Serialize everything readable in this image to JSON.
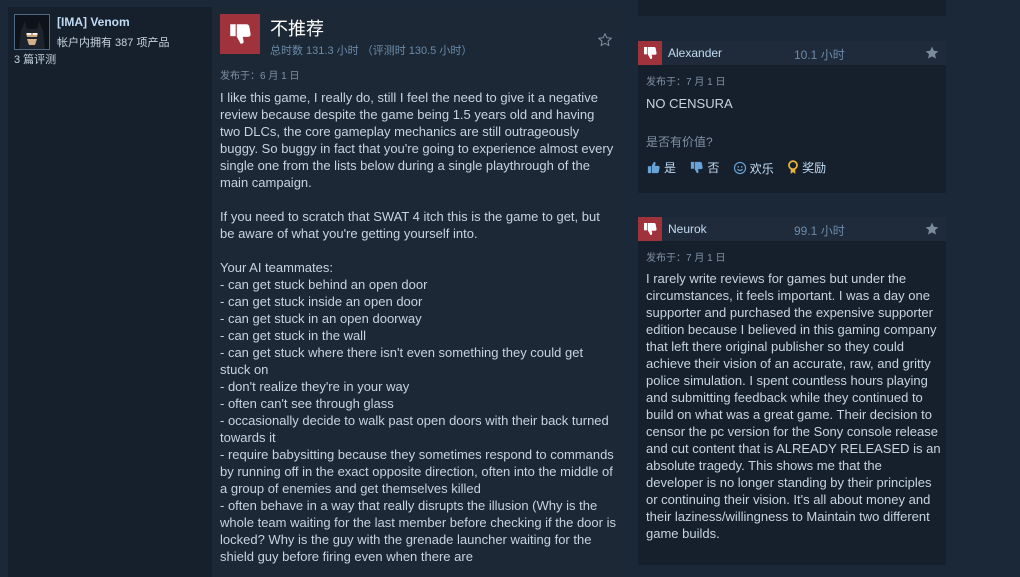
{
  "user": {
    "name": "[IMA] Venom",
    "products": "帐户内拥有 387 项产品",
    "reviews": "3 篇评测"
  },
  "review": {
    "verdict": "不推荐",
    "hours": "总时数 131.3 小时  （评测时 130.5 小时）",
    "posted": "发布于：6 月 1 日",
    "text": "I like this game, I really do, still I feel the need to give it a negative review because despite the game being 1.5 years old and having two DLCs, the core gameplay mechanics are still outrageously buggy. So buggy in fact that you're going to experience almost every single one from the lists below during a single playthrough of the main campaign.\n\nIf you need to scratch that SWAT 4 itch this is the game to get, but be aware of what you're getting yourself into.\n\nYour AI teammates:\n- can get stuck behind an open door\n- can get stuck inside an open door\n- can get stuck in an open doorway\n- can get stuck in the wall\n- can get stuck where there isn't even something they could get stuck on\n- don't realize they're in your way\n- often can't see through glass\n- occasionally decide to walk past open doors with their back turned towards it\n- require babysitting because they sometimes respond to commands by running off in the exact opposite direction, often into the middle of a group of enemies and get themselves killed\n- often behave in a way that really disrupts the illusion (Why is the whole team waiting for the last member before checking if the door is locked? Why is the guy with the grenade launcher waiting for the shield guy before firing even when there are"
  },
  "side_reviews": [
    {
      "author": "Alexander",
      "hours": "10.1 小时",
      "posted": "发布于：7 月 1 日",
      "text": "NO CENSURA",
      "helpful_question": "是否有价值?",
      "buttons": {
        "yes": "是",
        "no": "否",
        "funny": "欢乐",
        "award": "奖励"
      }
    },
    {
      "author": "Neurok",
      "hours": "99.1 小时",
      "posted": "发布于：7 月 1 日",
      "text": "I rarely write reviews for games but under the circumstances, it feels important. I was a day one supporter and purchased the expensive supporter edition because I believed in this gaming company that left there original publisher so they could achieve their vision of an accurate, raw, and gritty police simulation. I spent countless hours playing and submitting feedback while they continued to build on what was a great game. Their decision to censor the pc version for the Sony console release and cut content that is ALREADY RELEASED is an absolute tragedy. This shows me that the developer is no longer standing by their principles or continuing their vision. It's all about money and their laziness/willingness to Maintain two different game builds."
    }
  ],
  "colors": {
    "background": "#1b2838",
    "card": "#16202d",
    "not_recommended": "#a0323b",
    "link_text": "#c1dbf4"
  },
  "icons": {
    "thumbs_down": "thumbs-down-icon",
    "star": "star-icon",
    "thumbs_up": "thumbs-up-icon",
    "smiley": "smiley-icon",
    "award": "award-icon"
  }
}
